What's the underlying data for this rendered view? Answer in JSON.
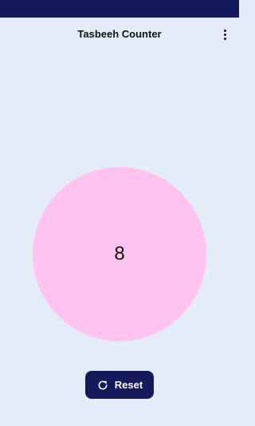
{
  "app": {
    "title": "Tasbeeh Counter",
    "menu_icon": "more-vert-icon"
  },
  "counter": {
    "value": "8"
  },
  "reset": {
    "label": "Reset",
    "icon": "refresh-icon"
  },
  "colors": {
    "status_bar": "#141a5a",
    "background": "#e3ecf7",
    "counter_circle": "#ffc3ef",
    "button": "#141a5a",
    "button_text": "#ffffff"
  }
}
